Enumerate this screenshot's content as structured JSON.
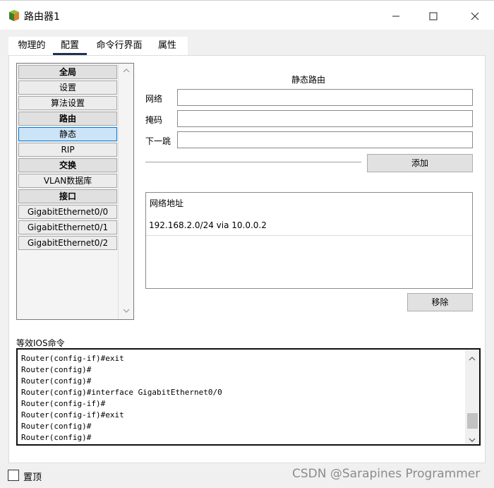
{
  "window": {
    "title": "路由器1",
    "minimize": "—",
    "maximize": "☐",
    "close": "✕"
  },
  "tabs": [
    {
      "label": "物理的"
    },
    {
      "label": "配置"
    },
    {
      "label": "命令行界面"
    },
    {
      "label": "属性"
    }
  ],
  "nav": {
    "items": [
      {
        "label": "全局",
        "header": true
      },
      {
        "label": "设置",
        "header": false
      },
      {
        "label": "算法设置",
        "header": false
      },
      {
        "label": "路由",
        "header": true
      },
      {
        "label": "静态",
        "header": false,
        "selected": true
      },
      {
        "label": "RIP",
        "header": false
      },
      {
        "label": "交换",
        "header": true
      },
      {
        "label": "VLAN数据库",
        "header": false
      },
      {
        "label": "接口",
        "header": true
      },
      {
        "label": "GigabitEthernet0/0",
        "header": false
      },
      {
        "label": "GigabitEthernet0/1",
        "header": false
      },
      {
        "label": "GigabitEthernet0/2",
        "header": false
      }
    ]
  },
  "static_route": {
    "title": "静态路由",
    "network_label": "网络",
    "network_value": "",
    "mask_label": "掩码",
    "mask_value": "",
    "next_hop_label": "下一跳",
    "next_hop_value": "",
    "add_button": "添加",
    "list_header": "网络地址",
    "routes": [
      "192.168.2.0/24 via 10.0.0.2"
    ],
    "remove_button": "移除"
  },
  "ios": {
    "label": "等效IOS命令",
    "lines": [
      "Router(config-if)#exit",
      "Router(config)#",
      "Router(config)#",
      "Router(config)#interface GigabitEthernet0/0",
      "Router(config-if)#",
      "Router(config-if)#exit",
      "Router(config)#",
      "Router(config)#"
    ]
  },
  "footer": {
    "pin_label": "置顶",
    "pin_checked": false,
    "watermark": "CSDN @Sarapines Programmer"
  }
}
